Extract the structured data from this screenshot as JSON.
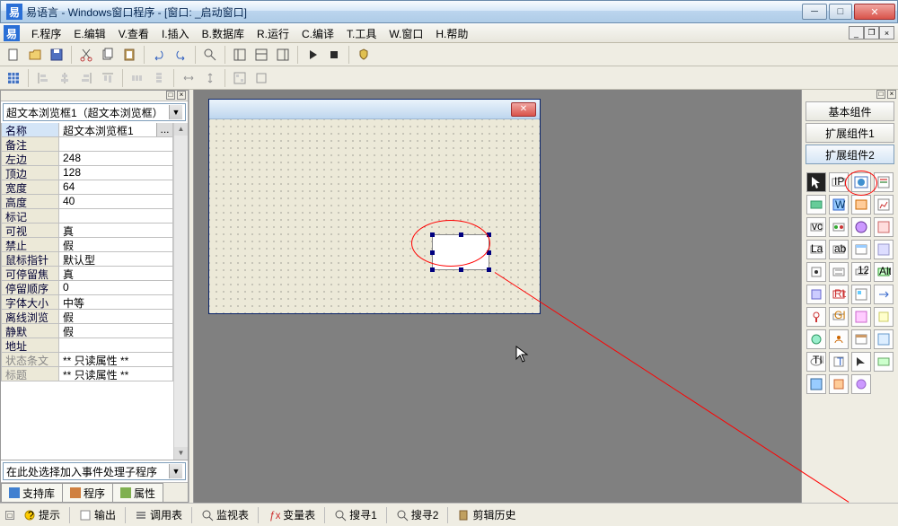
{
  "title": "易语言 - Windows窗口程序 - [窗口: _启动窗口]",
  "menus": [
    "F.程序",
    "E.编辑",
    "V.查看",
    "I.插入",
    "B.数据库",
    "R.运行",
    "C.编译",
    "T.工具",
    "W.窗口",
    "H.帮助"
  ],
  "combo_value": "超文本浏览框1（超文本浏览框）",
  "props": [
    {
      "name": "名称",
      "val": "超文本浏览框1",
      "sel": true
    },
    {
      "name": "备注",
      "val": ""
    },
    {
      "name": "左边",
      "val": "248"
    },
    {
      "name": "顶边",
      "val": "128"
    },
    {
      "name": "宽度",
      "val": "64"
    },
    {
      "name": "高度",
      "val": "40"
    },
    {
      "name": "标记",
      "val": ""
    },
    {
      "name": "可视",
      "val": "真"
    },
    {
      "name": "禁止",
      "val": "假"
    },
    {
      "name": "鼠标指针",
      "val": "默认型"
    },
    {
      "name": "可停留焦点",
      "val": "真"
    },
    {
      "name": "  停留顺序",
      "val": "0"
    },
    {
      "name": "字体大小",
      "val": "中等"
    },
    {
      "name": "离线浏览",
      "val": "假"
    },
    {
      "name": "静默",
      "val": "假"
    },
    {
      "name": "地址",
      "val": ""
    },
    {
      "name": "状态条文本",
      "val": "** 只读属性 **",
      "grey": true
    },
    {
      "name": "标题",
      "val": "** 只读属性 **",
      "grey": true
    }
  ],
  "event_combo": "在此处选择加入事件处理子程序",
  "left_tabs": [
    "支持库",
    "程序",
    "属性"
  ],
  "right_buttons": [
    "基本组件",
    "扩展组件1",
    "扩展组件2"
  ],
  "bottom_items": [
    "提示",
    "输出",
    "调用表",
    "监视表",
    "变量表",
    "搜寻1",
    "搜寻2",
    "剪辑历史"
  ]
}
